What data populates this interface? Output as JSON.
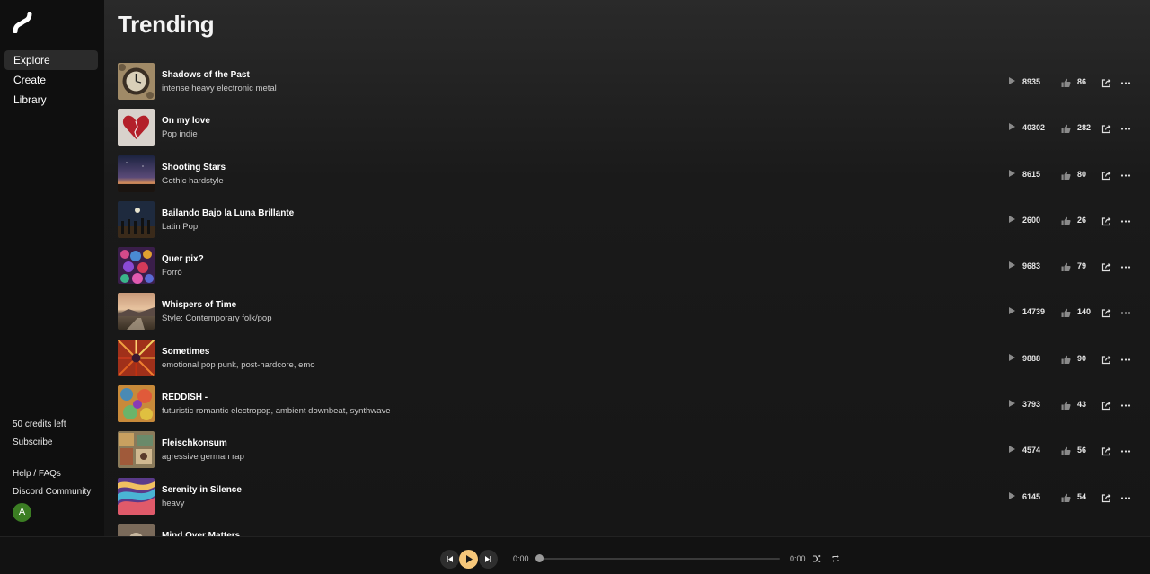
{
  "sidebar": {
    "nav": [
      {
        "label": "Explore",
        "active": true
      },
      {
        "label": "Create",
        "active": false
      },
      {
        "label": "Library",
        "active": false
      }
    ],
    "credits": "50 credits left",
    "subscribe": "Subscribe",
    "help": "Help / FAQs",
    "discord": "Discord Community",
    "avatar_initial": "A"
  },
  "main": {
    "title": "Trending",
    "tracks": [
      {
        "title": "Shadows of the Past",
        "style": "intense heavy electronic metal",
        "plays": "8935",
        "likes": "86",
        "art": "clock"
      },
      {
        "title": "On my love",
        "style": "Pop indie",
        "plays": "40302",
        "likes": "282",
        "art": "heart"
      },
      {
        "title": "Shooting Stars",
        "style": "Gothic hardstyle",
        "plays": "8615",
        "likes": "80",
        "art": "sky"
      },
      {
        "title": "Bailando Bajo la Luna Brillante",
        "style": "Latin Pop",
        "plays": "2600",
        "likes": "26",
        "art": "dancers"
      },
      {
        "title": "Quer pix?",
        "style": "Forró",
        "plays": "9683",
        "likes": "79",
        "art": "balloons"
      },
      {
        "title": "Whispers of Time",
        "style": "Style: Contemporary folk/pop",
        "plays": "14739",
        "likes": "140",
        "art": "landscape"
      },
      {
        "title": "Sometimes",
        "style": "emotional pop punk, post-hardcore, emo",
        "plays": "9888",
        "likes": "90",
        "art": "burst"
      },
      {
        "title": "REDDISH -",
        "style": "futuristic romantic electropop, ambient downbeat, synthwave",
        "plays": "3793",
        "likes": "43",
        "art": "abstract"
      },
      {
        "title": "Fleischkonsum",
        "style": "agressive german rap",
        "plays": "4574",
        "likes": "56",
        "art": "collage"
      },
      {
        "title": "Serenity in Silence",
        "style": "heavy",
        "plays": "6145",
        "likes": "54",
        "art": "swirl"
      },
      {
        "title": "Mind Over Matters",
        "style": "",
        "plays": "",
        "likes": "",
        "art": "partial"
      }
    ]
  },
  "player": {
    "current_time": "0:00",
    "total_time": "0:00",
    "progress": 0
  },
  "colors": {
    "accent_play": "#f6c77a",
    "avatar": "#3b7d23",
    "active_nav": "#2b2b2b"
  }
}
